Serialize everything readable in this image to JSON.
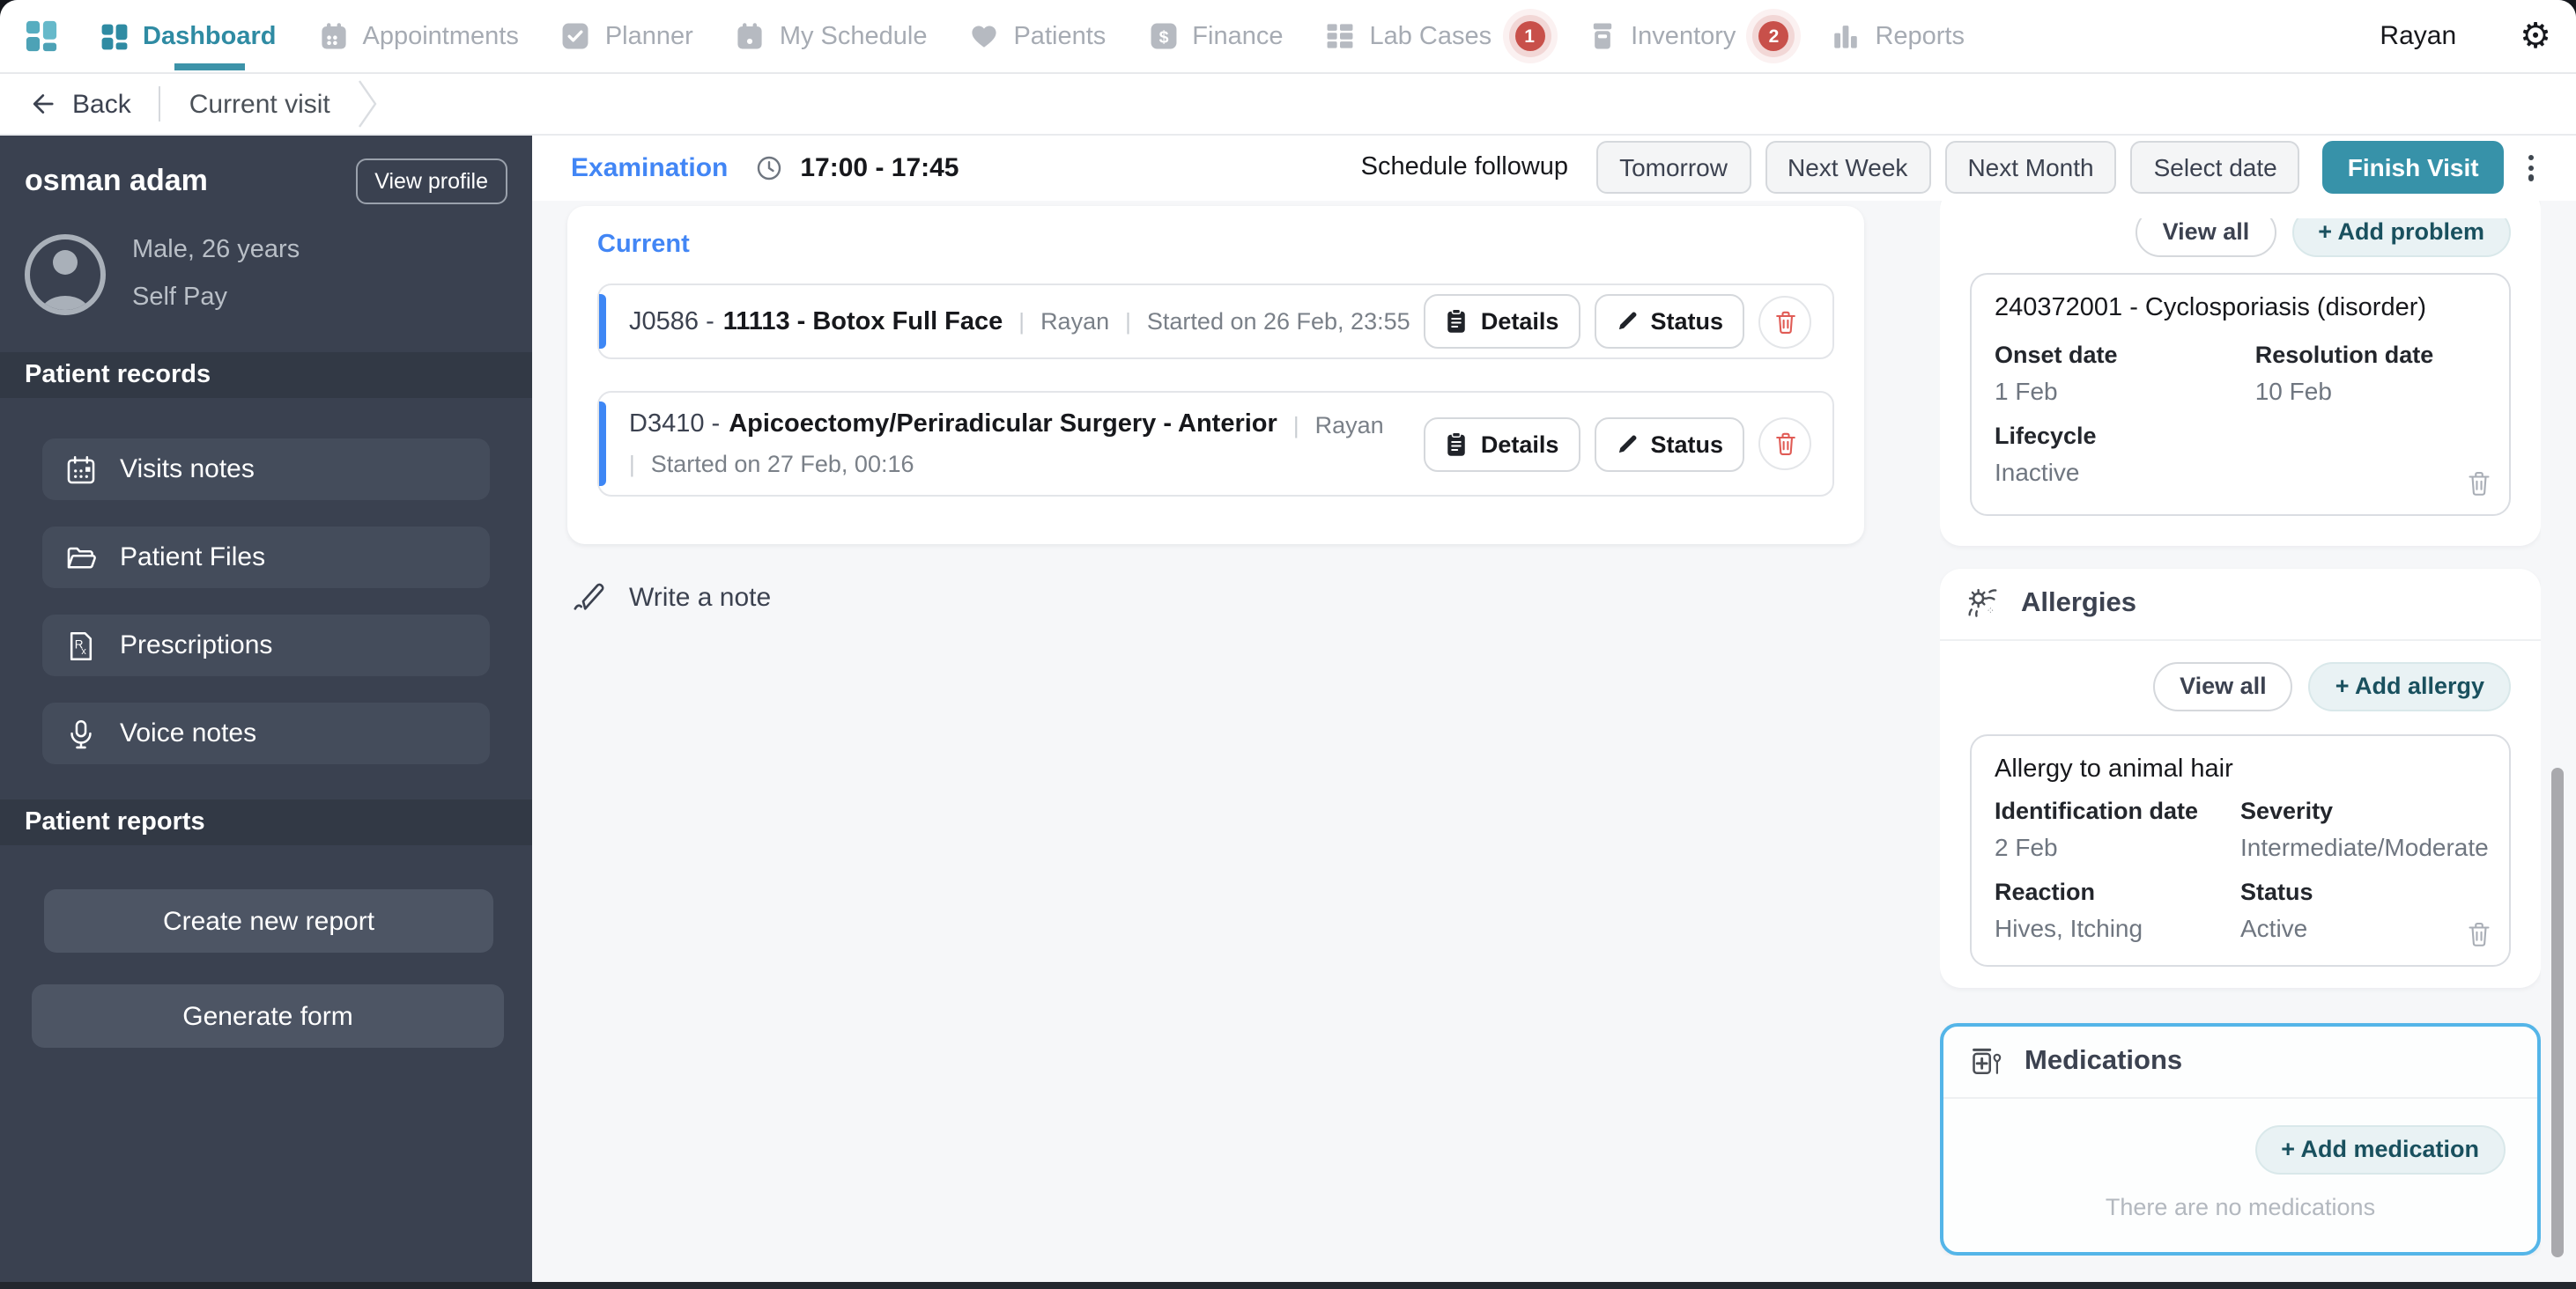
{
  "nav": {
    "items": [
      {
        "label": "Dashboard",
        "active": true
      },
      {
        "label": "Appointments"
      },
      {
        "label": "Planner"
      },
      {
        "label": "My Schedule"
      },
      {
        "label": "Patients"
      },
      {
        "label": "Finance"
      },
      {
        "label": "Lab Cases",
        "badge": "1"
      },
      {
        "label": "Inventory",
        "badge": "2"
      },
      {
        "label": "Reports"
      }
    ],
    "user": "Rayan"
  },
  "breadcrumb": {
    "back": "Back",
    "current": "Current visit"
  },
  "sidebar": {
    "patient": {
      "name": "osman adam",
      "view_profile": "View profile",
      "demographics": "Male, 26 years",
      "payment": "Self Pay"
    },
    "records_heading": "Patient records",
    "records_items": [
      {
        "label": "Visits notes"
      },
      {
        "label": "Patient Files"
      },
      {
        "label": "Prescriptions"
      },
      {
        "label": "Voice notes"
      }
    ],
    "reports_heading": "Patient reports",
    "report_actions": [
      {
        "label": "Create new report"
      },
      {
        "label": "Generate form"
      }
    ]
  },
  "visit_header": {
    "stage": "Examination",
    "time": "17:00 - 17:45",
    "schedule_label": "Schedule followup",
    "followup_options": [
      {
        "label": "Tomorrow"
      },
      {
        "label": "Next Week"
      },
      {
        "label": "Next Month"
      },
      {
        "label": "Select date"
      }
    ],
    "finish": "Finish Visit"
  },
  "procedures": {
    "section": "Current",
    "sep": "|",
    "actions": {
      "details": "Details",
      "status": "Status"
    },
    "items": [
      {
        "code": "J0586 -",
        "name": "11113 - Botox Full Face",
        "provider": "Rayan",
        "started": "Started on 26 Feb, 23:55"
      },
      {
        "code": "D3410 -",
        "name": "Apicoectomy/Periradicular Surgery - Anterior",
        "provider": "Rayan",
        "started": "Started on 27 Feb, 00:16"
      }
    ]
  },
  "note": {
    "placeholder": "Write a note"
  },
  "problems": {
    "view_all": "View all",
    "add": "+ Add problem",
    "card": {
      "title": "240372001 - Cyclosporiasis (disorder)",
      "onset_label": "Onset date",
      "onset": "1 Feb",
      "resolution_label": "Resolution date",
      "resolution": "10 Feb",
      "lifecycle_label": "Lifecycle",
      "lifecycle": "Inactive"
    }
  },
  "allergies": {
    "title": "Allergies",
    "view_all": "View all",
    "add": "+ Add allergy",
    "card": {
      "title": "Allergy to animal hair",
      "identification_label": "Identification date",
      "identification": "2 Feb",
      "severity_label": "Severity",
      "severity": "Intermediate/Moderate",
      "reaction_label": "Reaction",
      "reaction": "Hives, Itching",
      "status_label": "Status",
      "status": "Active"
    }
  },
  "medications": {
    "title": "Medications",
    "add": "+ Add medication",
    "empty": "There are no medications"
  },
  "colors": {
    "accent_teal": "#3792a9",
    "accent_blue": "#4286f5",
    "highlight_blue": "#54b5e8",
    "badge_red": "#c8504a"
  }
}
